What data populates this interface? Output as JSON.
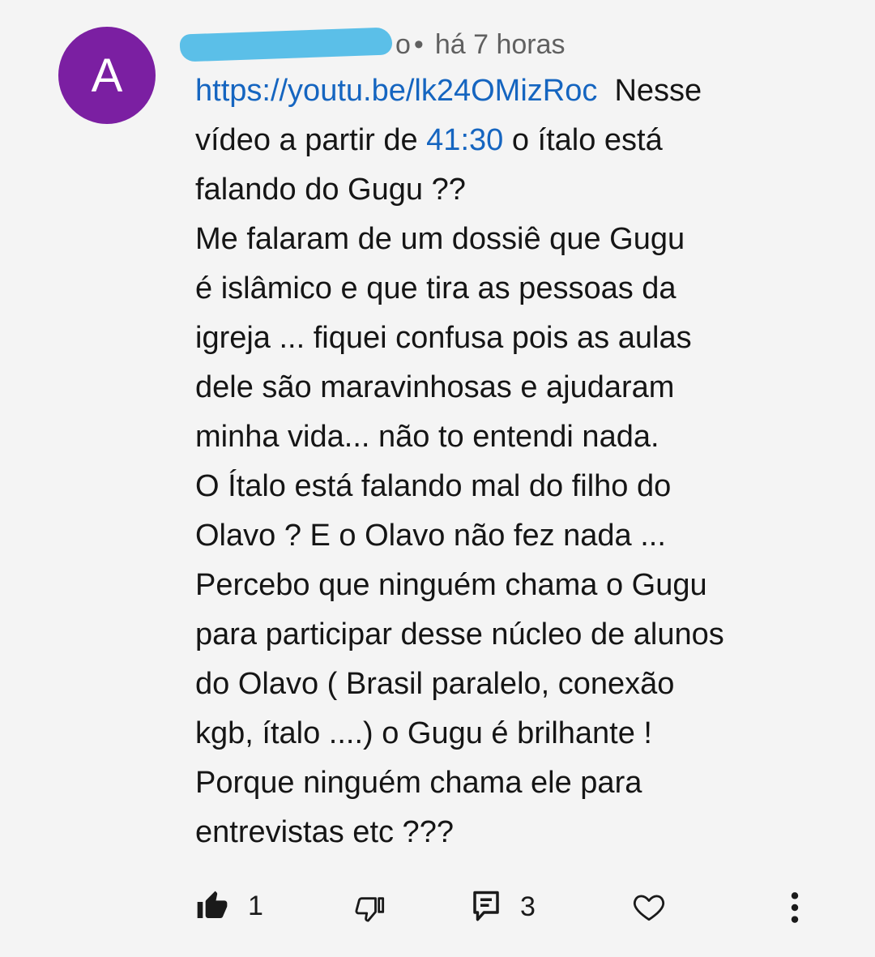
{
  "comment": {
    "avatar_letter": "A",
    "author_partial": "o",
    "separator": "•",
    "time": "há 7 horas",
    "link_text": "https://youtu.be/lk24OMizRoc",
    "text_after_link": "  Nesse\nvídeo a partir de ",
    "timestamp_link": "41:30",
    "text_rest": " o ítalo está\nfalando do Gugu ??\nMe falaram de um dossiê que Gugu\né islâmico e que tira as pessoas da\nigreja ... fiquei confusa pois as aulas\ndele são maravinhosas e ajudaram\nminha vida... não to entendi nada.\nO Ítalo está falando mal do filho do\nOlavo ? E o Olavo não fez nada ...\nPercebo que ninguém chama o Gugu\npara participar desse núcleo de alunos\ndo Olavo ( Brasil paralelo, conexão\nkgb, ítalo ....) o Gugu é brilhante !\nPorque ninguém chama ele para\nentrevistas etc ???"
  },
  "actions": {
    "like_count": "1",
    "reply_count": "3"
  },
  "colors": {
    "avatar": "#7b1fa2",
    "link": "#1565c0",
    "redaction": "#5bbfe8",
    "background": "#f4f4f4"
  },
  "icons": [
    "thumb-up-filled-icon",
    "thumb-down-icon",
    "reply-comment-icon",
    "heart-icon",
    "more-vertical-icon"
  ]
}
